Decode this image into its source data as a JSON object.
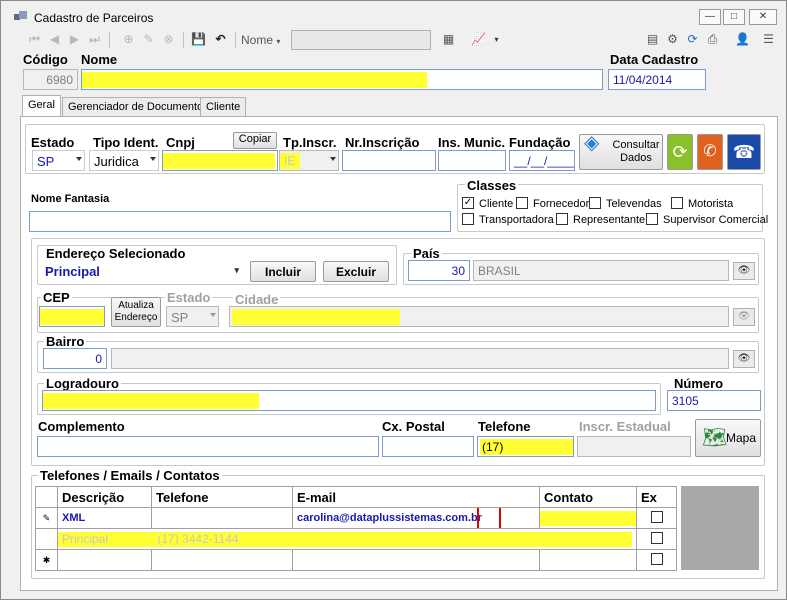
{
  "window": {
    "title": "Cadastro de Parceiros",
    "minimize_label": "—",
    "maximize_label": "□",
    "close_label": "✕"
  },
  "toolbar": {
    "sort_label": "Nome",
    "search_value": ""
  },
  "header": {
    "codigo_label": "Código",
    "codigo_value": "6980",
    "nome_label": "Nome",
    "nome_value": "",
    "data_cadastro_label": "Data Cadastro",
    "data_cadastro_value": "11/04/2014"
  },
  "tabs": [
    {
      "label": "Geral"
    },
    {
      "label": "Gerenciador de Documentos"
    },
    {
      "label": "Cliente"
    }
  ],
  "identification": {
    "estado_label": "Estado",
    "estado_value": "SP",
    "tipo_ident_label": "Tipo Ident.",
    "tipo_ident_value": "Juridica",
    "cnpj_label": "Cnpj",
    "copiar_label": "Copiar",
    "cnpj_value": "",
    "tp_inscr_label": "Tp.Inscr.",
    "tp_inscr_value": "IE",
    "nr_inscricao_label": "Nr.Inscrição",
    "nr_inscricao_value": "",
    "ins_munic_label": "Ins. Munic.",
    "ins_munic_value": "",
    "fundacao_label": "Fundação",
    "fundacao_value": "__/__/____",
    "consultar_label_1": "Consultar",
    "consultar_label_2": "Dados"
  },
  "nome_fantasia": {
    "label": "Nome Fantasia",
    "value": ""
  },
  "classes": {
    "label": "Classes",
    "items": [
      {
        "label": "Cliente",
        "checked": "✓"
      },
      {
        "label": "Fornecedor",
        "checked": ""
      },
      {
        "label": "Televendas",
        "checked": ""
      },
      {
        "label": "Motorista",
        "checked": ""
      },
      {
        "label": "Transportadora",
        "checked": ""
      },
      {
        "label": "Representante",
        "checked": ""
      },
      {
        "label": "Supervisor Comercial",
        "checked": ""
      }
    ]
  },
  "endereco": {
    "selecionado_label": "Endereço Selecionado",
    "selecionado_value": "Principal",
    "incluir_label": "Incluir",
    "excluir_label": "Excluir",
    "pais_label": "País",
    "pais_code": "30",
    "pais_name": "BRASIL",
    "cep_label": "CEP",
    "cep_value": "",
    "atualiza_label_1": "Atualiza",
    "atualiza_label_2": "Endereço",
    "estado_label": "Estado",
    "estado_value": "SP",
    "cidade_label": "Cidade",
    "cidade_value": "",
    "bairro_label": "Bairro",
    "bairro_code": "0",
    "bairro_name": "",
    "logradouro_label": "Logradouro",
    "logradouro_value": "",
    "numero_label": "Número",
    "numero_value": "3105",
    "complemento_label": "Complemento",
    "complemento_value": "",
    "cx_postal_label": "Cx. Postal",
    "cx_postal_value": "",
    "telefone_label": "Telefone",
    "telefone_value": "(17)",
    "inscr_estadual_label": "Inscr. Estadual",
    "inscr_estadual_value": "",
    "mapa_label": "Mapa"
  },
  "contacts": {
    "label": "Telefones / Emails / Contatos",
    "columns": [
      "Descrição",
      "Telefone",
      "E-mail",
      "Contato",
      "Ex"
    ],
    "rows": [
      {
        "marker": "✎",
        "descricao": "XML",
        "telefone": "",
        "email": "carolina@dataplussistemas.com.br",
        "contato": "",
        "ex": ""
      },
      {
        "marker": "",
        "descricao": "Principal",
        "telefone": "(17) 3442-1144",
        "email": "",
        "contato": "",
        "ex": ""
      },
      {
        "marker": "✱",
        "descricao": "",
        "telefone": "",
        "email": "",
        "contato": "",
        "ex": ""
      }
    ]
  }
}
